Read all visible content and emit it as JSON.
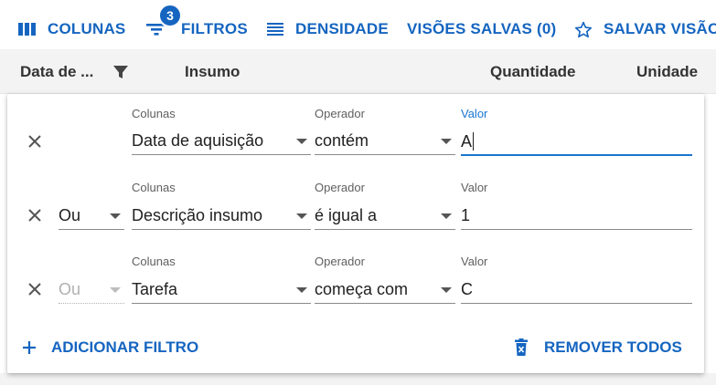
{
  "toolbar": {
    "columns_label": "COLUNAS",
    "filters_label": "FILTROS",
    "filters_badge": "3",
    "density_label": "DENSIDADE",
    "saved_views_label": "VISÕES SALVAS (0)",
    "save_view_label": "SALVAR VISÃO",
    "accent_color": "#1565c0"
  },
  "header": {
    "col_date": "Data de ...",
    "col_insumo": "Insumo",
    "col_quantidade": "Quantidade",
    "col_unidade": "Unidade"
  },
  "filters": {
    "labels": {
      "columns": "Colunas",
      "operator": "Operador",
      "value": "Valor"
    },
    "rows": [
      {
        "logic": "",
        "column": "Data de aquisição",
        "operator": "contém",
        "value": "A"
      },
      {
        "logic": "Ou",
        "column": "Descrição insumo",
        "operator": "é igual a",
        "value": "1"
      },
      {
        "logic": "Ou",
        "column": "Tarefa",
        "operator": "começa com",
        "value": "C"
      }
    ],
    "add_label": "ADICIONAR FILTRO",
    "remove_all_label": "REMOVER TODOS"
  }
}
